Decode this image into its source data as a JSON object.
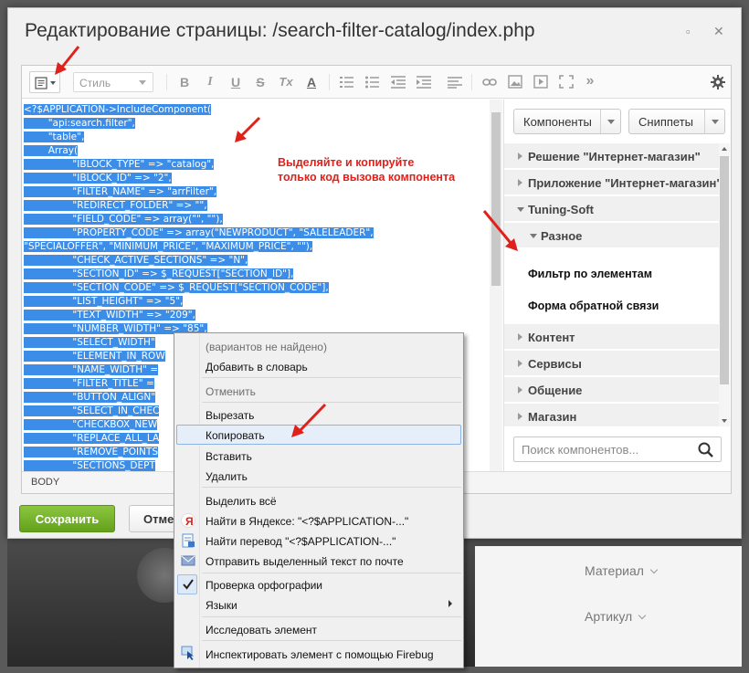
{
  "dialog": {
    "title": "Редактирование страницы: /search-filter-catalog/index.php",
    "minimize_label": "▫",
    "close_label": "✕"
  },
  "toolbar": {
    "style_placeholder": "Стиль",
    "bold": "B",
    "italic": "I",
    "underline": "U",
    "strike": "S",
    "clear_format": "Tx",
    "text_color": "A",
    "more": "»"
  },
  "code_lines": [
    "<?$APPLICATION->IncludeComponent(",
    "        \"api:search.filter\",",
    "        \"table\",",
    "        Array(",
    "                \"IBLOCK_TYPE\" => \"catalog\",",
    "                \"IBLOCK_ID\" => \"2\",",
    "                \"FILTER_NAME\" => \"arrFilter\",",
    "                \"REDIRECT_FOLDER\" => \"\",",
    "                \"FIELD_CODE\" => array(\"\", \"\"),",
    "                \"PROPERTY_CODE\" => array(\"NEWPRODUCT\", \"SALELEADER\",",
    "\"SPECIALOFFER\", \"MINIMUM_PRICE\", \"MAXIMUM_PRICE\", \"\"),",
    "                \"CHECK_ACTIVE_SECTIONS\" => \"N\",",
    "                \"SECTION_ID\" => $_REQUEST[\"SECTION_ID\"],",
    "                \"SECTION_CODE\" => $_REQUEST[\"SECTION_CODE\"],",
    "                \"LIST_HEIGHT\" => \"5\",",
    "                \"TEXT_WIDTH\" => \"209\",",
    "                \"NUMBER_WIDTH\" => \"85\",",
    "                \"SELECT_WIDTH\"",
    "                \"ELEMENT_IN_ROW",
    "                \"NAME_WIDTH\" =",
    "                \"FILTER_TITLE\" =",
    "                \"BUTTON_ALIGN\"",
    "                \"SELECT_IN_CHEC",
    "                \"CHECKBOX_NEW",
    "                \"REPLACE_ALL_LA",
    "                \"REMOVE_POINTS",
    "                \"SECTIONS_DEPT"
  ],
  "hint": {
    "line1": "Выделяйте и копируйте",
    "line2": "только код вызова компонента"
  },
  "status_bar": {
    "path": "BODY"
  },
  "right_panel": {
    "components_label": "Компоненты",
    "snippets_label": "Сниппеты",
    "tree": [
      "Решение \"Интернет-магазин\"",
      "Приложение \"Интернет-магазин\"",
      "Tuning-Soft",
      "Разное",
      "Контент",
      "Сервисы",
      "Общение",
      "Магазин"
    ],
    "leaves": [
      "Фильтр по элементам",
      "Форма обратной связи"
    ],
    "search_placeholder": "Поиск компонентов..."
  },
  "buttons": {
    "save": "Сохранить",
    "cancel": "Отме"
  },
  "background": {
    "material": "Материал",
    "article": "Артикул"
  },
  "context_menu": {
    "no_variants": "(вариантов не найдено)",
    "add_dictionary": "Добавить в словарь",
    "undo": "Отменить",
    "cut": "Вырезать",
    "copy": "Копировать",
    "paste": "Вставить",
    "delete": "Удалить",
    "select_all": "Выделить всё",
    "yandex_search": "Найти в Яндексе: \"<?$APPLICATION-...\"",
    "translate": "Найти перевод \"<?$APPLICATION-...\"",
    "send_email": "Отправить выделенный текст по почте",
    "spellcheck": "Проверка орфографии",
    "languages": "Языки",
    "inspect": "Исследовать элемент",
    "firebug": "Инспектировать элемент с помощью Firebug"
  },
  "colors": {
    "accent_red": "#e0211b",
    "selection": "#3b8de8",
    "save_green": "#6aaa22"
  }
}
